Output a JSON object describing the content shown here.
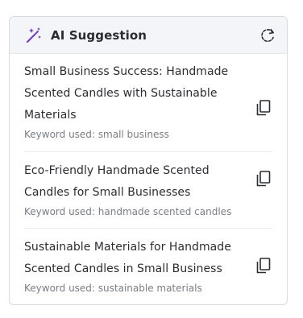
{
  "panel": {
    "title": "AI Suggestion",
    "header_icon": "magic-wand-icon",
    "refresh_icon": "refresh-icon",
    "accent_color": "#6d3bd6"
  },
  "suggestions": [
    {
      "title": "Small Business Success: Handmade Scented Candles with Sustainable Materials",
      "keyword": "Keyword used: small business",
      "copy_icon": "copy-icon"
    },
    {
      "title": "Eco-Friendly Handmade Scented Candles for Small Businesses",
      "keyword": "Keyword used: handmade scented candles",
      "copy_icon": "copy-icon"
    },
    {
      "title": "Sustainable Materials for Handmade Scented Candles in Small Business",
      "keyword": "Keyword used: sustainable materials",
      "copy_icon": "copy-icon"
    }
  ]
}
